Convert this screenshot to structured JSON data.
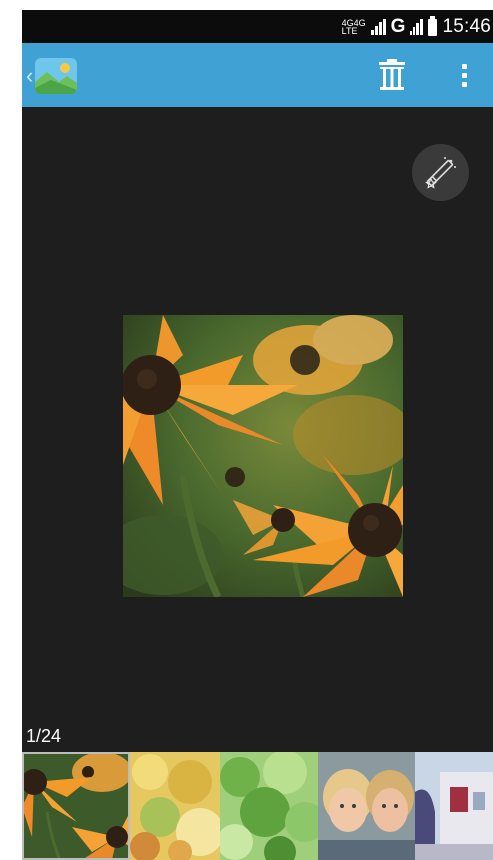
{
  "status_bar": {
    "network_top": "4G",
    "network_top2": "4G",
    "network_bottom": "LTE",
    "carrier": "G",
    "time": "15:46"
  },
  "app_bar": {
    "back_icon": "chevron-left-icon",
    "app_icon": "gallery-icon",
    "delete_icon": "trash-icon",
    "menu_icon": "overflow-menu-icon",
    "background_color": "#3fa1d4"
  },
  "viewer": {
    "edit_icon": "magic-wand-icon",
    "photo": "orange-flowers-photo",
    "counter": "1/24"
  },
  "filmstrip": {
    "thumbnails": [
      "orange-flowers",
      "yellow-leaves",
      "green-leaves",
      "two-children",
      "building"
    ],
    "selected_index": 0
  }
}
